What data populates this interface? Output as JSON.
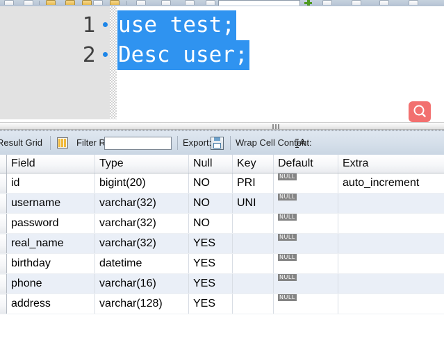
{
  "toolbar": {
    "icons": [
      "new-file-icon",
      "open-file-icon",
      "save-icon",
      "execute-icon",
      "execute-current-icon",
      "explain-icon",
      "stop-icon",
      "toggle-commit-icon",
      "commit-icon",
      "rollback-icon",
      "beautify-icon"
    ],
    "add-snippet-icon": "plus-icon",
    "search_box_value": ""
  },
  "editor": {
    "lines": [
      {
        "number": "1",
        "text": "use test;",
        "selected": true,
        "marker": true
      },
      {
        "number": "2",
        "text": "Desc user;",
        "selected": true,
        "marker": true
      }
    ],
    "selection_color": "#2f93f0",
    "gutter_color": "#e2e2e2"
  },
  "find_button": {
    "icon": "search-icon",
    "color": "#f2706f"
  },
  "splitter": {
    "grip": "splitter-grip-icon"
  },
  "result_toolbar": {
    "title": "Result Grid",
    "grid_icon": "grid-view-icon",
    "filter_label": "Filter Rows:",
    "filter_value": "",
    "filter_placeholder": "",
    "export_label": "Export:",
    "export_icon": "export-save-icon",
    "wrap_label": "Wrap Cell Content:",
    "wrap_icon": "wrap-text-icon"
  },
  "result_grid": {
    "columns": [
      "Field",
      "Type",
      "Null",
      "Key",
      "Default",
      "Extra"
    ],
    "rows": [
      {
        "field": "id",
        "type": "bigint(20)",
        "null": "NO",
        "key": "PRI",
        "default": "NULL",
        "extra": "auto_increment"
      },
      {
        "field": "username",
        "type": "varchar(32)",
        "null": "NO",
        "key": "UNI",
        "default": "NULL",
        "extra": ""
      },
      {
        "field": "password",
        "type": "varchar(32)",
        "null": "NO",
        "key": "",
        "default": "NULL",
        "extra": ""
      },
      {
        "field": "real_name",
        "type": "varchar(32)",
        "null": "YES",
        "key": "",
        "default": "NULL",
        "extra": ""
      },
      {
        "field": "birthday",
        "type": "datetime",
        "null": "YES",
        "key": "",
        "default": "NULL",
        "extra": ""
      },
      {
        "field": "phone",
        "type": "varchar(16)",
        "null": "YES",
        "key": "",
        "default": "NULL",
        "extra": ""
      },
      {
        "field": "address",
        "type": "varchar(128)",
        "null": "YES",
        "key": "",
        "default": "NULL",
        "extra": ""
      }
    ]
  }
}
